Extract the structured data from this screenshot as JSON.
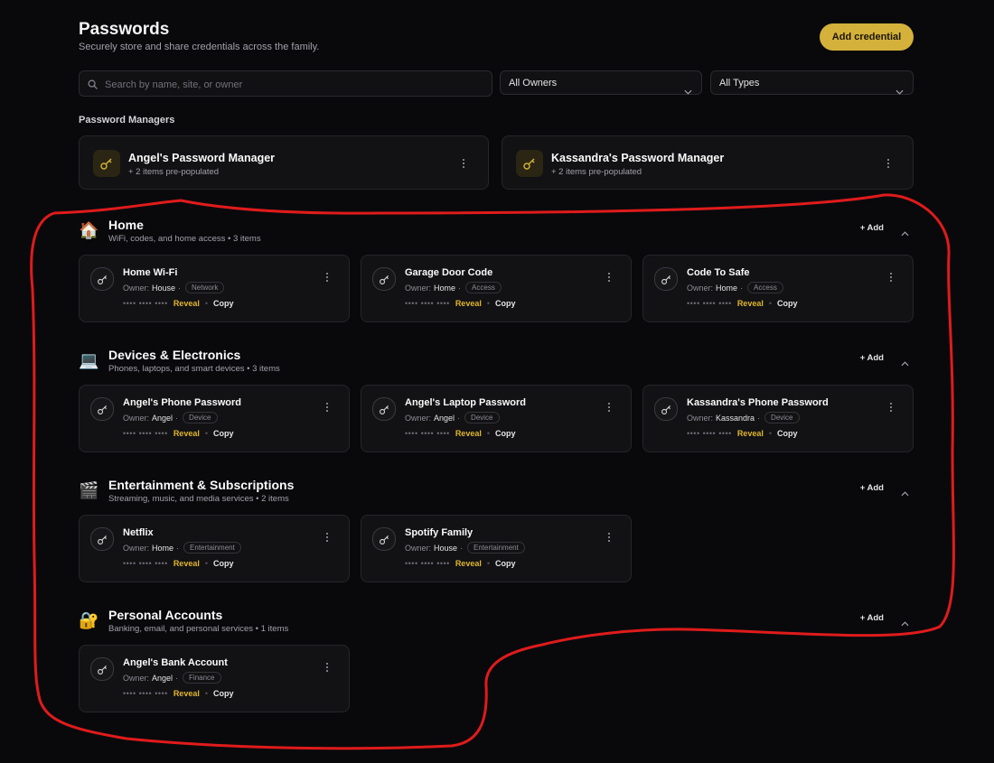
{
  "page": {
    "title": "Passwords",
    "subtitle": "Securely store and share credentials across the family.",
    "add_button": "Add credential"
  },
  "filters": {
    "search_placeholder": "Search by name, site, or owner",
    "owner_selected": "All Owners",
    "type_selected": "All Types"
  },
  "managers": {
    "label": "Password Managers",
    "items": [
      {
        "name": "Angel's Password Manager",
        "sub": "+ 2 items pre-populated"
      },
      {
        "name": "Kassandra's Password Manager",
        "sub": "+ 2 items pre-populated"
      }
    ]
  },
  "common": {
    "add_label": "+ Add",
    "owner_prefix": "Owner:",
    "dot_sep": "·",
    "bullet": "•",
    "masked": "•••• •••• ••••",
    "reveal": "Reveal",
    "copy": "Copy"
  },
  "categories": [
    {
      "emoji": "🏠",
      "title": "Home",
      "sub": "WiFi, codes, and home access • 3 items",
      "items": [
        {
          "name": "Home Wi-Fi",
          "owner": "House",
          "tag": "Network"
        },
        {
          "name": "Garage Door Code",
          "owner": "Home",
          "tag": "Access"
        },
        {
          "name": "Code To Safe",
          "owner": "Home",
          "tag": "Access"
        }
      ]
    },
    {
      "emoji": "💻",
      "title": "Devices & Electronics",
      "sub": "Phones, laptops, and smart devices • 3 items",
      "items": [
        {
          "name": "Angel's Phone Password",
          "owner": "Angel",
          "tag": "Device"
        },
        {
          "name": "Angel's Laptop Password",
          "owner": "Angel",
          "tag": "Device"
        },
        {
          "name": "Kassandra's Phone Password",
          "owner": "Kassandra",
          "tag": "Device"
        }
      ]
    },
    {
      "emoji": "🎬",
      "title": "Entertainment & Subscriptions",
      "sub": "Streaming, music, and media services • 2 items",
      "items": [
        {
          "name": "Netflix",
          "owner": "Home",
          "tag": "Entertainment"
        },
        {
          "name": "Spotify Family",
          "owner": "House",
          "tag": "Entertainment"
        }
      ]
    },
    {
      "emoji": "🔐",
      "title": "Personal Accounts",
      "sub": "Banking, email, and personal services • 1 items",
      "items": [
        {
          "name": "Angel's Bank Account",
          "owner": "Angel",
          "tag": "Finance"
        }
      ]
    }
  ],
  "colors": {
    "accent": "#d4b13a",
    "reveal": "#e0b52e",
    "annotation": "#e01b1b",
    "background": "#09090c"
  }
}
